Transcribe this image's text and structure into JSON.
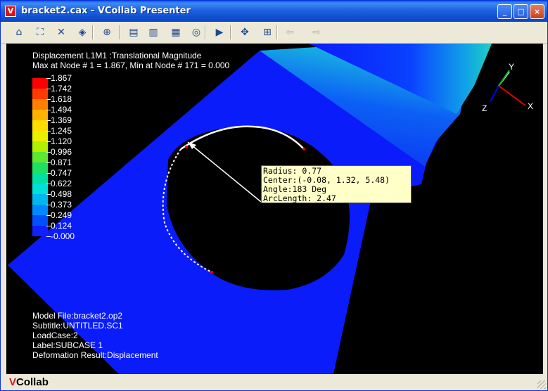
{
  "window": {
    "title": "bracket2.cax - VCollab Presenter",
    "app_icon_letter": "V",
    "controls": {
      "minimize": "_",
      "maximize": "□",
      "close": "×"
    }
  },
  "toolbar": {
    "tools": [
      {
        "name": "home-view-icon",
        "glyph": "⌂",
        "enabled": true
      },
      {
        "name": "fit-view-icon",
        "glyph": "⛶",
        "enabled": true
      },
      {
        "name": "zoom-extents-icon",
        "glyph": "✕",
        "enabled": true
      },
      {
        "name": "view-cube-icon",
        "glyph": "◈",
        "enabled": true
      },
      {
        "name": "section-icon",
        "glyph": "⊕",
        "enabled": true
      },
      {
        "name": "parts-list-icon",
        "glyph": "▤",
        "enabled": true
      },
      {
        "name": "results-icon",
        "glyph": "▥",
        "enabled": true
      },
      {
        "name": "legend-icon",
        "glyph": "▦",
        "enabled": true
      },
      {
        "name": "probe-icon",
        "glyph": "◎",
        "enabled": true
      },
      {
        "name": "play-icon",
        "glyph": "▶",
        "enabled": true
      },
      {
        "name": "pan-icon",
        "glyph": "✥",
        "enabled": true
      },
      {
        "name": "zoom-region-icon",
        "glyph": "⊞",
        "enabled": true
      },
      {
        "name": "back-arrow-icon",
        "glyph": "⇦",
        "enabled": false
      },
      {
        "name": "forward-arrow-icon",
        "glyph": "⇨",
        "enabled": false
      }
    ]
  },
  "viewport": {
    "header_line1": "Displacement L1M1 :Translational Magnitude",
    "header_line2": "Max at Node # 1 = 1.867, Min at Node # 171 = 0.000",
    "legend": {
      "values": [
        "1.867",
        "1.742",
        "1.618",
        "1.494",
        "1.369",
        "1.245",
        "1.120",
        "0.996",
        "0.871",
        "0.747",
        "0.622",
        "0.498",
        "0.373",
        "0.249",
        "0.124",
        "-0.000"
      ],
      "colors": [
        "#ff0000",
        "#ff3b00",
        "#ff8000",
        "#ffb000",
        "#ffdc00",
        "#e8f000",
        "#b0f000",
        "#60e830",
        "#20e060",
        "#00e0a0",
        "#00e0d8",
        "#00b8f0",
        "#0088ff",
        "#0050ff",
        "#1020ff"
      ]
    },
    "tooltip": {
      "radius": "Radius: 0.77",
      "center": "Center:(-0.08, 1.32, 5.48)",
      "angle": "Angle:183 Deg",
      "arc_length": "ArcLength: 2.47"
    },
    "model_info": {
      "model_file": "Model File:bracket2.op2",
      "subtitle": "Subtitle:UNTITLED.SC1",
      "loadcase": "LoadCase:2",
      "label": "Label:SUBCASE 1",
      "deformation": "Deformation Result:Displacement"
    },
    "axes": {
      "y": "Y",
      "z": "Z",
      "x": "X"
    },
    "colors": {
      "plate": "#0a1cfa",
      "background": "#000000"
    }
  },
  "status": {
    "logo_v": "V",
    "logo_rest": "Collab"
  }
}
